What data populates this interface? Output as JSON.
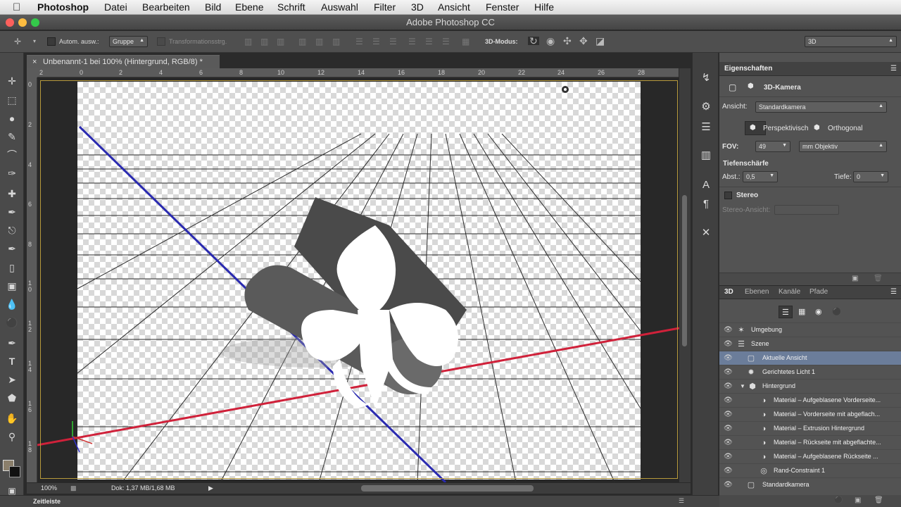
{
  "menubar": {
    "items": [
      "Photoshop",
      "Datei",
      "Bearbeiten",
      "Bild",
      "Ebene",
      "Schrift",
      "Auswahl",
      "Filter",
      "3D",
      "Ansicht",
      "Fenster",
      "Hilfe"
    ]
  },
  "window": {
    "title": "Adobe Photoshop CC"
  },
  "options": {
    "auto_select_label": "Autom. ausw.:",
    "auto_select_value": "Gruppe",
    "transform_label": "Transformationsstrg.",
    "mode_label": "3D-Modus:",
    "workspace_value": "3D"
  },
  "document": {
    "tab_title": "Unbenannt-1 bei 100% (Hintergrund, RGB/8) *",
    "ruler_h": [
      "2",
      "0",
      "2",
      "4",
      "6",
      "8",
      "10",
      "12",
      "14",
      "16",
      "18",
      "20",
      "22",
      "24",
      "26",
      "28"
    ],
    "ruler_v": [
      "0",
      "2",
      "4",
      "6",
      "8",
      "1\n0",
      "1\n2",
      "1\n4",
      "1\n6",
      "1\n8"
    ]
  },
  "status": {
    "zoom": "100%",
    "doc_size": "Dok: 1,37 MB/1,68 MB"
  },
  "bottom": {
    "timeline_label": "Zeitleiste"
  },
  "properties": {
    "tab_label": "Eigenschaften",
    "camera_title": "3D-Kamera",
    "view_label": "Ansicht:",
    "view_value": "Standardkamera",
    "perspective_label": "Perspektivisch",
    "orthogonal_label": "Orthogonal",
    "fov_label": "FOV:",
    "fov_value": "49",
    "fov_unit": "mm Objektiv",
    "dof_label": "Tiefenschärfe",
    "dist_label": "Abst.:",
    "dist_value": "0,5",
    "depth_label": "Tiefe:",
    "depth_value": "0",
    "stereo_label": "Stereo",
    "stereo_view_label": "Stereo-Ansicht:"
  },
  "panel3d": {
    "tabs": [
      "3D",
      "Ebenen",
      "Kanäle",
      "Pfade"
    ],
    "rows": [
      {
        "name": "Umgebung",
        "icon": "environment-icon"
      },
      {
        "name": "Szene",
        "icon": "scene-icon"
      },
      {
        "name": "Aktuelle Ansicht",
        "icon": "camera-icon"
      },
      {
        "name": "Gerichtetes Licht 1",
        "icon": "light-icon"
      },
      {
        "name": "Hintergrund",
        "icon": "mesh-icon"
      },
      {
        "name": "Material – Aufgeblasene Vorderseite...",
        "icon": "material-icon"
      },
      {
        "name": "Material – Vorderseite mit abgeflach...",
        "icon": "material-icon"
      },
      {
        "name": "Material – Extrusion Hintergrund",
        "icon": "material-icon"
      },
      {
        "name": "Material – Rückseite mit abgeflachte...",
        "icon": "material-icon"
      },
      {
        "name": "Material – Aufgeblasene Rückseite ...",
        "icon": "material-icon"
      },
      {
        "name": "Rand-Constraint 1",
        "icon": "constraint-icon"
      },
      {
        "name": "Standardkamera",
        "icon": "camera-icon"
      }
    ],
    "selected_row": "Aktuelle Ansicht"
  },
  "colors": {
    "accent_selection": "#6b7d9a",
    "x_axis": "#d0213a",
    "z_axis": "#2a2ab0"
  }
}
